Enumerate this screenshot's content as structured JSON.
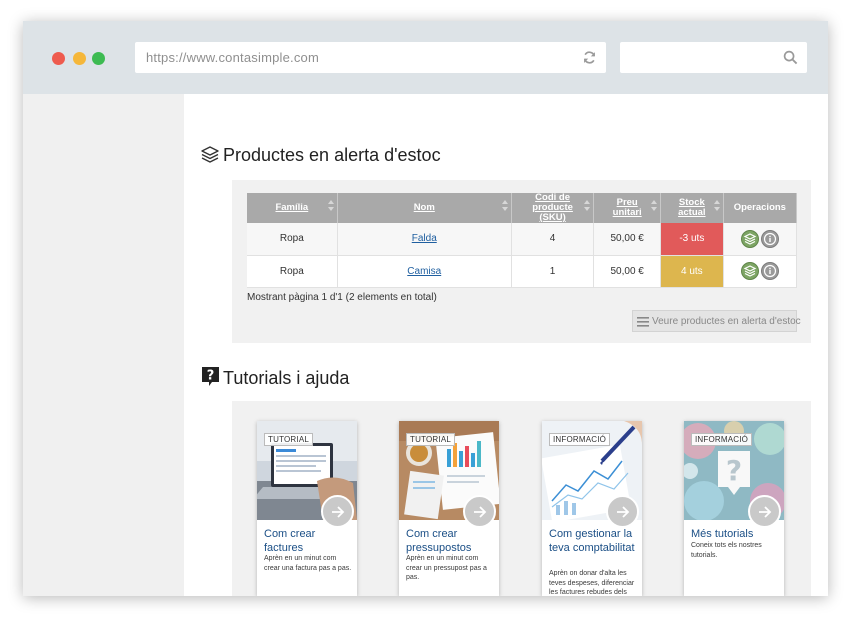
{
  "browser": {
    "url": "https://www.contasimple.com",
    "search_placeholder": ""
  },
  "stock_section": {
    "title": "Productes en alerta d'estoc",
    "columns": [
      "Família",
      "Nom",
      "Codi de producte (SKU)",
      "Preu unitari",
      "Stock actual",
      "Operacions"
    ],
    "rows": [
      {
        "family": "Ropa",
        "name": "Falda",
        "sku": "4",
        "price": "50,00 €",
        "stock": "-3 uts",
        "stock_status": "red"
      },
      {
        "family": "Ropa",
        "name": "Camisa",
        "sku": "1",
        "price": "50,00 €",
        "stock": "4 uts",
        "stock_status": "yellow"
      }
    ],
    "paging": "Mostrant pàgina 1 d'1 (2 elements en total)",
    "view_button": "Veure productes en alerta d'estoc",
    "colors": {
      "red": "#e15a5a",
      "yellow": "#ddb64e",
      "header": "#a9a9a9"
    }
  },
  "tutorials_section": {
    "title": "Tutorials i ajuda",
    "cards": [
      {
        "tag": "TUTORIAL",
        "title": "Com crear factures",
        "description": "Aprèn en un minut com crear una factura pas a pas."
      },
      {
        "tag": "TUTORIAL",
        "title": "Com crear pressupostos",
        "description": "Aprèn en un minut com crear un pressupost pas a pas."
      },
      {
        "tag": "INFORMACIÓ",
        "title": "Com gestionar la teva comptabilitat",
        "description": "Aprèn on donar d'alta les teves despeses, diferenciar les factures rebudes dels"
      },
      {
        "tag": "INFORMACIÓ",
        "title": "Més tutorials",
        "description": "Coneix tots els nostres tutorials."
      }
    ]
  }
}
